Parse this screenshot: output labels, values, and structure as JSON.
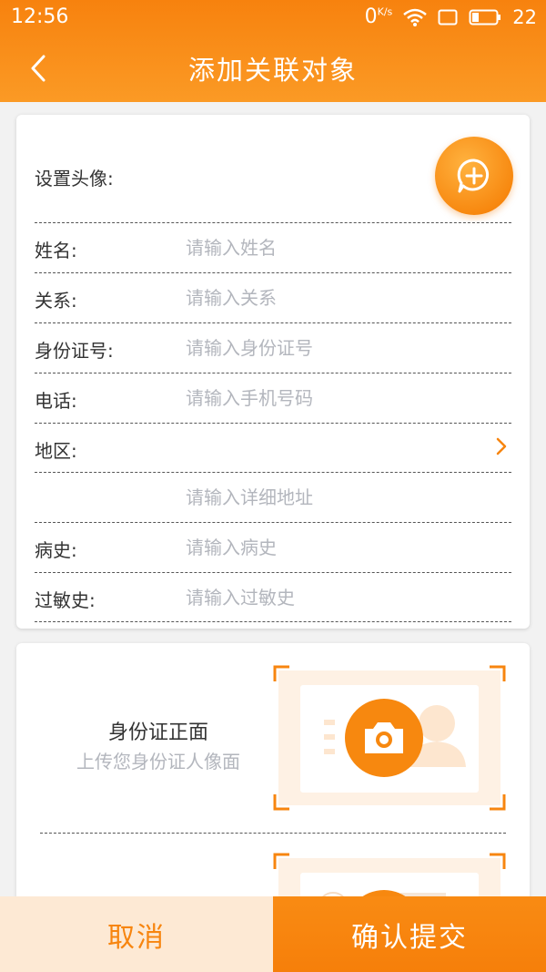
{
  "status_bar": {
    "time": "12:56",
    "net_speed": "0",
    "net_unit": "K/s",
    "battery": "22"
  },
  "header": {
    "title": "添加关联对象",
    "back_icon": "chevron-left-icon"
  },
  "colors": {
    "accent": "#f7850f",
    "placeholder": "#b3b6bd",
    "cancel_bg": "#fde9d4"
  },
  "form": {
    "avatar_label": "设置头像:",
    "avatar_icon": "add-chat-icon",
    "fields": [
      {
        "label": "姓名:",
        "placeholder": "请输入姓名",
        "value": ""
      },
      {
        "label": "关系:",
        "placeholder": "请输入关系",
        "value": ""
      },
      {
        "label": "身份证号:",
        "placeholder": "请输入身份证号",
        "value": ""
      },
      {
        "label": "电话:",
        "placeholder": "请输入手机号码",
        "value": ""
      },
      {
        "label": "地区:",
        "placeholder": "",
        "value": ""
      },
      {
        "label": "",
        "placeholder": "请输入详细地址",
        "value": ""
      },
      {
        "label": "病史:",
        "placeholder": "请输入病史",
        "value": ""
      },
      {
        "label": "过敏史:",
        "placeholder": "请输入过敏史",
        "value": ""
      }
    ]
  },
  "id_upload": {
    "front_title": "身份证正面",
    "front_subtitle": "上传您身份证人像面",
    "camera_icon": "camera-icon"
  },
  "buttons": {
    "cancel": "取消",
    "submit": "确认提交"
  }
}
